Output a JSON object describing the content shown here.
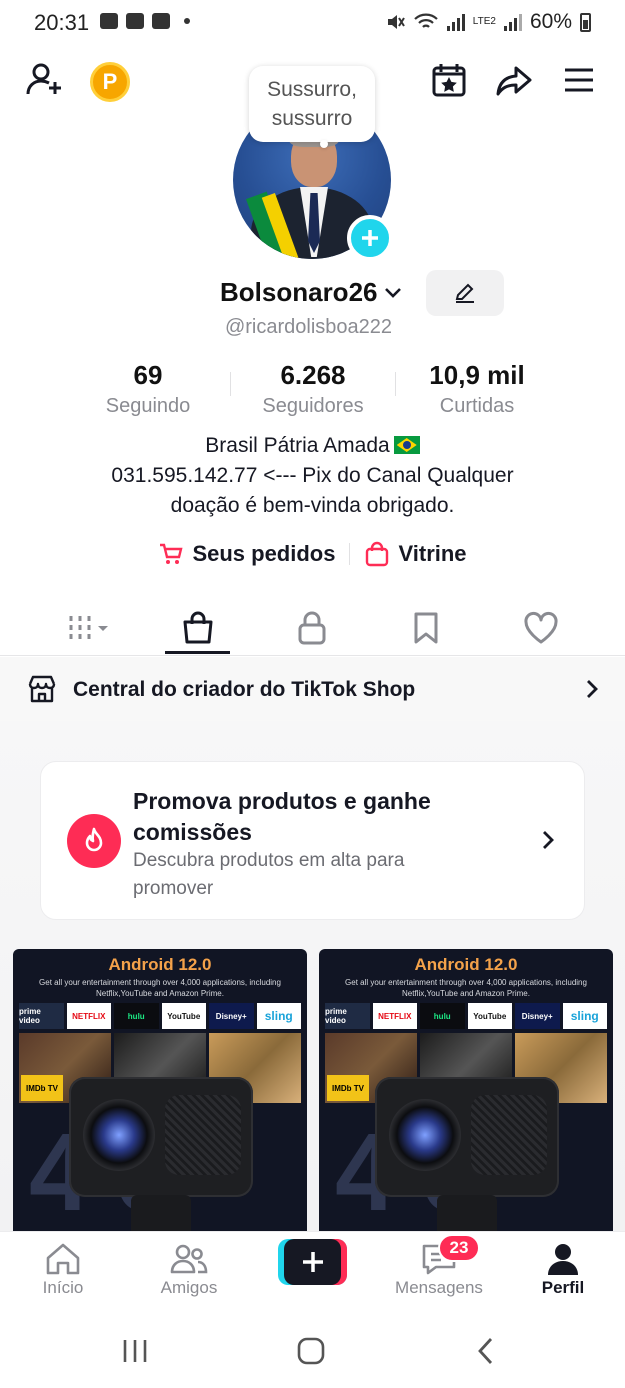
{
  "status_bar": {
    "time": "20:31",
    "network": "LTE2",
    "battery": "60%"
  },
  "top_bar": {
    "coin_label": "P"
  },
  "bubble": {
    "line1": "Sussurro,",
    "line2": "sussurro"
  },
  "profile": {
    "display_name": "Bolsonaro26",
    "handle": "@ricardolisboa222",
    "stats": [
      {
        "value": "69",
        "label": "Seguindo"
      },
      {
        "value": "6.268",
        "label": "Seguidores"
      },
      {
        "value": "10,9 mil",
        "label": "Curtidas"
      }
    ],
    "bio": {
      "line1": "Brasil Pátria Amada",
      "line2": "031.595.142.77 <--- Pix do Canal Qualquer",
      "line3": "doação é bem-vinda obrigado."
    },
    "links": {
      "orders": "Seus pedidos",
      "showcase": "Vitrine"
    }
  },
  "shop_row": {
    "label": "Central do criador do TikTok Shop"
  },
  "promo": {
    "title": "Promova produtos e ganhe comissões",
    "subtitle": "Descubra produtos em alta para promover"
  },
  "products": [
    {
      "title": "Android 12.0",
      "subtitle": "Get all your entertainment through over 4,000 applications, including Netflix,YouTube and Amazon Prime.",
      "logos": [
        "prime video",
        "NETFLIX",
        "hulu",
        "YouTube",
        "Disney+",
        "sling"
      ],
      "badge": "IMDb TV"
    },
    {
      "title": "Android 12.0",
      "subtitle": "Get all your entertainment through over 4,000 applications, including Netflix,YouTube and Amazon Prime.",
      "logos": [
        "prime video",
        "NETFLIX",
        "hulu",
        "YouTube",
        "Disney+",
        "sling"
      ],
      "badge": "IMDb TV"
    }
  ],
  "bottom_nav": {
    "home": "Início",
    "friends": "Amigos",
    "messages": "Mensagens",
    "messages_badge": "23",
    "profile": "Perfil"
  },
  "colors": {
    "accent_red": "#fe2c55",
    "accent_cyan": "#20d5ec",
    "text_primary": "#161823",
    "text_secondary": "#8a8b91",
    "coin": "#f7a600"
  }
}
